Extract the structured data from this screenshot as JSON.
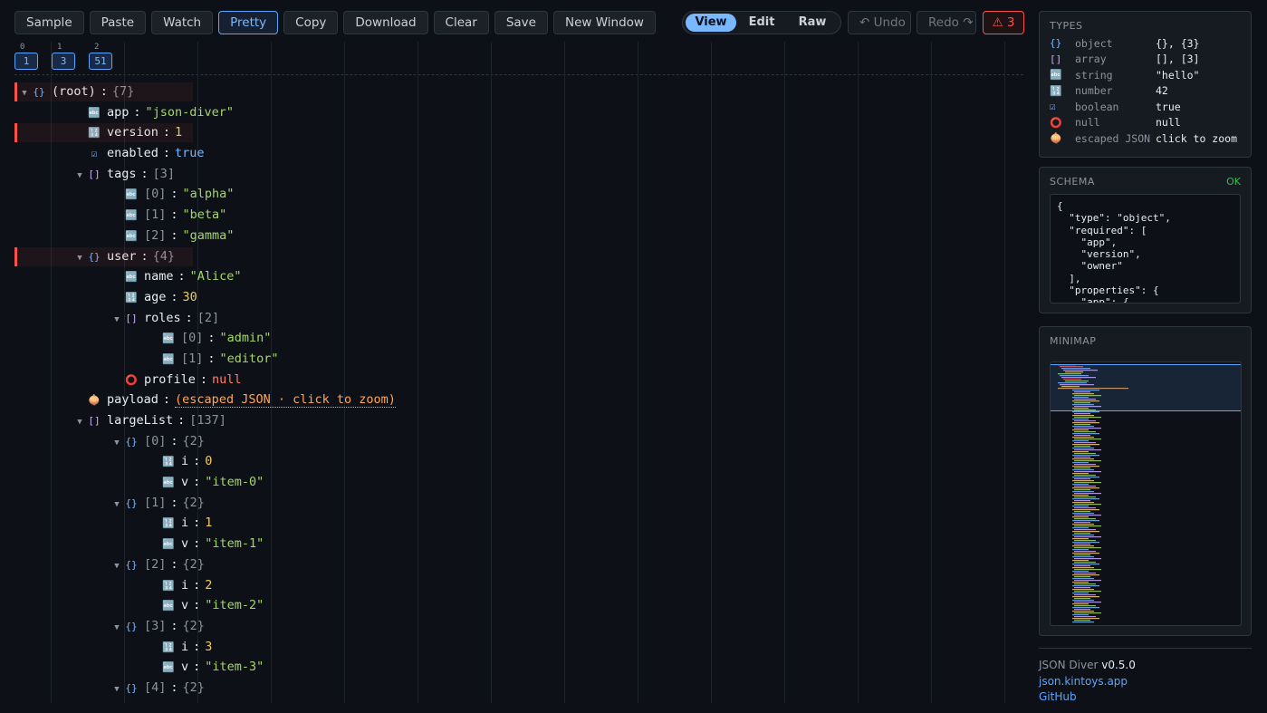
{
  "toolbar": {
    "buttons": [
      "Sample",
      "Paste",
      "Watch",
      "Pretty",
      "Copy",
      "Download",
      "Clear",
      "Save",
      "New Window"
    ],
    "active": "Pretty"
  },
  "mode": {
    "options": [
      "View",
      "Edit",
      "Raw"
    ],
    "selected": "View"
  },
  "history": {
    "undo": "↶ Undo",
    "redo": "Redo ↷"
  },
  "errors_badge": "⚠ 3",
  "depth_chips": [
    {
      "level": "0",
      "count": "1"
    },
    {
      "level": "1",
      "count": "3"
    },
    {
      "level": "2",
      "count": "51"
    }
  ],
  "tree": [
    {
      "depth": 0,
      "twisty": true,
      "icon": "obj",
      "key": "(root)",
      "meta": "{7}",
      "hl": true
    },
    {
      "depth": 1,
      "icon": "str",
      "key": "app",
      "value": "\"json-diver\"",
      "vt": "str"
    },
    {
      "depth": 1,
      "icon": "num",
      "key": "version",
      "value": "1",
      "vt": "num",
      "hl": true
    },
    {
      "depth": 1,
      "icon": "bool",
      "key": "enabled",
      "value": "true",
      "vt": "bool"
    },
    {
      "depth": 1,
      "twisty": true,
      "icon": "arr",
      "key": "tags",
      "meta": "[3]"
    },
    {
      "depth": 2,
      "icon": "str",
      "idx": "[0]",
      "value": "\"alpha\"",
      "vt": "str"
    },
    {
      "depth": 2,
      "icon": "str",
      "idx": "[1]",
      "value": "\"beta\"",
      "vt": "str"
    },
    {
      "depth": 2,
      "icon": "str",
      "idx": "[2]",
      "value": "\"gamma\"",
      "vt": "str"
    },
    {
      "depth": 1,
      "twisty": true,
      "icon": "obj",
      "key": "user",
      "meta": "{4}",
      "hl": true
    },
    {
      "depth": 2,
      "icon": "str",
      "key": "name",
      "value": "\"Alice\"",
      "vt": "str"
    },
    {
      "depth": 2,
      "icon": "num",
      "key": "age",
      "value": "30",
      "vt": "num"
    },
    {
      "depth": 2,
      "twisty": true,
      "icon": "arr",
      "key": "roles",
      "meta": "[2]"
    },
    {
      "depth": 3,
      "icon": "str",
      "idx": "[0]",
      "value": "\"admin\"",
      "vt": "str"
    },
    {
      "depth": 3,
      "icon": "str",
      "idx": "[1]",
      "value": "\"editor\"",
      "vt": "str"
    },
    {
      "depth": 2,
      "icon": "nul",
      "key": "profile",
      "value": "null",
      "vt": "null"
    },
    {
      "depth": 1,
      "icon": "esc",
      "key": "payload",
      "value": "(escaped JSON · click to zoom)",
      "vt": "esc"
    },
    {
      "depth": 1,
      "twisty": true,
      "icon": "arr",
      "key": "largeList",
      "meta": "[137]"
    },
    {
      "depth": 2,
      "twisty": true,
      "icon": "obj",
      "idx": "[0]",
      "meta": "{2}"
    },
    {
      "depth": 3,
      "icon": "num",
      "key": "i",
      "value": "0",
      "vt": "num"
    },
    {
      "depth": 3,
      "icon": "str",
      "key": "v",
      "value": "\"item-0\"",
      "vt": "str"
    },
    {
      "depth": 2,
      "twisty": true,
      "icon": "obj",
      "idx": "[1]",
      "meta": "{2}"
    },
    {
      "depth": 3,
      "icon": "num",
      "key": "i",
      "value": "1",
      "vt": "num"
    },
    {
      "depth": 3,
      "icon": "str",
      "key": "v",
      "value": "\"item-1\"",
      "vt": "str"
    },
    {
      "depth": 2,
      "twisty": true,
      "icon": "obj",
      "idx": "[2]",
      "meta": "{2}"
    },
    {
      "depth": 3,
      "icon": "num",
      "key": "i",
      "value": "2",
      "vt": "num"
    },
    {
      "depth": 3,
      "icon": "str",
      "key": "v",
      "value": "\"item-2\"",
      "vt": "str"
    },
    {
      "depth": 2,
      "twisty": true,
      "icon": "obj",
      "idx": "[3]",
      "meta": "{2}"
    },
    {
      "depth": 3,
      "icon": "num",
      "key": "i",
      "value": "3",
      "vt": "num"
    },
    {
      "depth": 3,
      "icon": "str",
      "key": "v",
      "value": "\"item-3\"",
      "vt": "str"
    },
    {
      "depth": 2,
      "twisty": true,
      "icon": "obj",
      "idx": "[4]",
      "meta": "{2}"
    }
  ],
  "icons": {
    "obj": "{}",
    "arr": "[]",
    "str": "🔤",
    "num": "🔢",
    "bool": "☑",
    "nul": "⭕",
    "esc": "🧅"
  },
  "types_panel": {
    "title": "TYPES",
    "rows": [
      {
        "icon": "obj",
        "name": "object",
        "example": "{}, {3}"
      },
      {
        "icon": "arr",
        "name": "array",
        "example": "[], [3]"
      },
      {
        "icon": "str",
        "name": "string",
        "example": "\"hello\""
      },
      {
        "icon": "num",
        "name": "number",
        "example": "42"
      },
      {
        "icon": "bool",
        "name": "boolean",
        "example": "true"
      },
      {
        "icon": "nul",
        "name": "null",
        "example": "null"
      },
      {
        "icon": "esc",
        "name": "escaped JSON",
        "example": "click to zoom"
      }
    ]
  },
  "schema_panel": {
    "title": "SCHEMA",
    "status": "OK",
    "text": "{\n  \"type\": \"object\",\n  \"required\": [\n    \"app\",\n    \"version\",\n    \"owner\"\n  ],\n  \"properties\": {\n    \"app\": {"
  },
  "minimap_panel": {
    "title": "MINIMAP"
  },
  "footer": {
    "app_name": "JSON Diver",
    "version": "v0.5.0",
    "site": "json.kintoys.app",
    "github": "GitHub"
  },
  "colors": {
    "accent": "#58a6ff",
    "error": "#f85149",
    "string": "#a5d66b",
    "number": "#f2cc60",
    "ok": "#3fb950"
  }
}
